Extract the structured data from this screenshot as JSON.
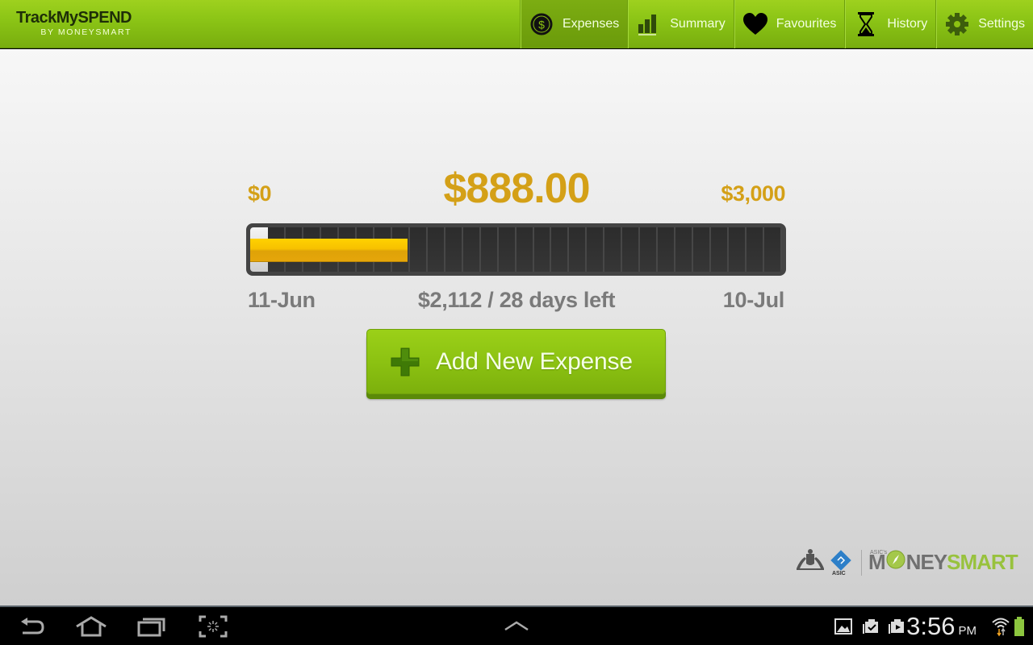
{
  "app": {
    "title": "TrackMySPEND",
    "subtitle": "BY MONEYSMART"
  },
  "nav": {
    "items": [
      {
        "label": "Expenses",
        "icon": "dollar-coin-icon",
        "active": true
      },
      {
        "label": "Summary",
        "icon": "bar-chart-icon",
        "active": false
      },
      {
        "label": "Favourites",
        "icon": "heart-icon",
        "active": false
      },
      {
        "label": "History",
        "icon": "hourglass-icon",
        "active": false
      },
      {
        "label": "Settings",
        "icon": "gear-icon",
        "active": false
      }
    ]
  },
  "budget": {
    "min_label": "$0",
    "max_label": "$3,000",
    "spent_label": "$888.00",
    "spent_fraction": 0.296,
    "start_date": "11-Jun",
    "end_date": "10-Jul",
    "remaining_label": "$2,112 / 28 days left"
  },
  "add_button": {
    "label": "Add New Expense",
    "icon": "plus-icon"
  },
  "footer": {
    "asic_label": "ASIC",
    "asics_label": "ASIC's",
    "brand_money": "M",
    "brand_ney": "NEY",
    "brand_smart": "SMART"
  },
  "system_bar": {
    "time": "3:56",
    "ampm": "PM",
    "colors": {
      "battery": "#8cc63f"
    }
  },
  "colors": {
    "accent_green": "#8cc212",
    "amount_gold": "#d4a017",
    "muted_gray": "#7a7a7a"
  }
}
